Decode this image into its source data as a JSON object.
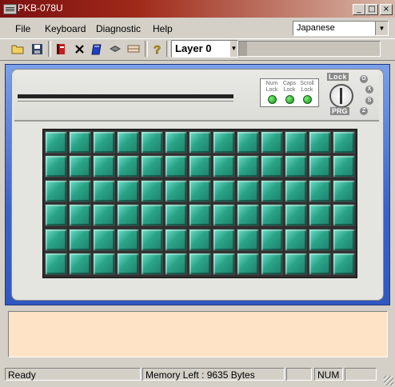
{
  "window": {
    "title": "PKB-078U",
    "buttons": [
      "_",
      "□",
      "×"
    ]
  },
  "menu": {
    "items": [
      "File",
      "Keyboard",
      "Diagnostic",
      "Help"
    ],
    "language_select": {
      "value": "Japanese"
    }
  },
  "toolbar": {
    "icons": [
      "open-folder-icon",
      "save-disk-icon",
      "red-book-icon",
      "delete-x-icon",
      "blue-book-icon",
      "layer-stack-icon",
      "bar-icon",
      "help-question-icon"
    ],
    "layer_select": {
      "value": "Layer 0"
    }
  },
  "keyboard": {
    "led_labels": [
      [
        "Num",
        "Lock"
      ],
      [
        "Caps",
        "Lock"
      ],
      [
        "Scroll",
        "Lock"
      ]
    ],
    "led_color": "#2aa52a",
    "lock_label": "Lock",
    "prg_label": "PRG",
    "key_positions": [
      "O",
      "X",
      "S",
      "Z"
    ],
    "rows": 6,
    "cols": 13,
    "key_color": "#2aa488"
  },
  "message_area": {
    "text": "",
    "background": "#ffe3c6"
  },
  "status": {
    "ready": "Ready",
    "memory": "Memory Left :  9635 Bytes",
    "pane3": "",
    "num": "NUM",
    "pane5": ""
  }
}
